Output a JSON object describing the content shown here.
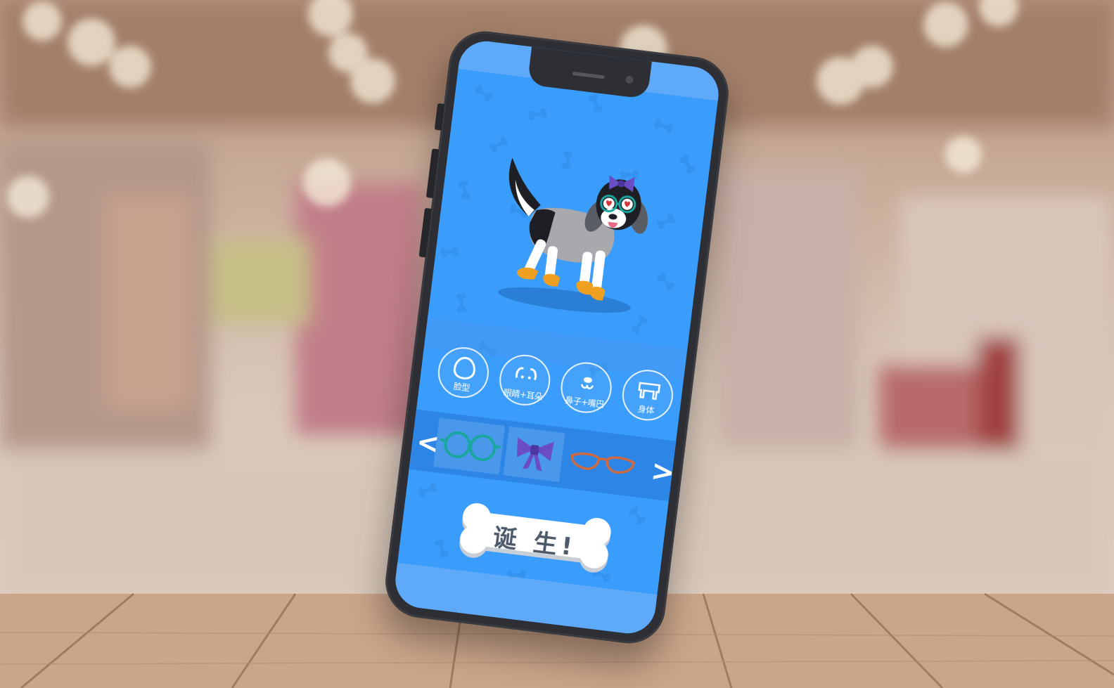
{
  "categories": [
    {
      "id": "face",
      "label": "脸型"
    },
    {
      "id": "eyes-ears",
      "label": "眼睛+耳朵"
    },
    {
      "id": "nose-mouth",
      "label": "鼻子+嘴巴"
    },
    {
      "id": "body",
      "label": "身体"
    }
  ],
  "accessories": [
    {
      "id": "round-glasses",
      "icon": "round-glasses-icon",
      "color": "#1aa69e",
      "selected": true
    },
    {
      "id": "purple-bow",
      "icon": "bow-icon",
      "color": "#6a4dc4",
      "selected": true
    },
    {
      "id": "cat-eye-glasses",
      "icon": "cat-eye-glasses-icon",
      "color": "#d26a3f",
      "selected": false
    }
  ],
  "nav": {
    "prev_label": "<",
    "next_label": ">"
  },
  "birth_button": {
    "label": "诞 生!"
  },
  "colors": {
    "screen_bg": "#3a9dfb",
    "strip_bg": "#2d86e6",
    "dog_gray": "#a7a9ad",
    "dog_black": "#1d1f24",
    "paw_orange": "#f0a020"
  }
}
